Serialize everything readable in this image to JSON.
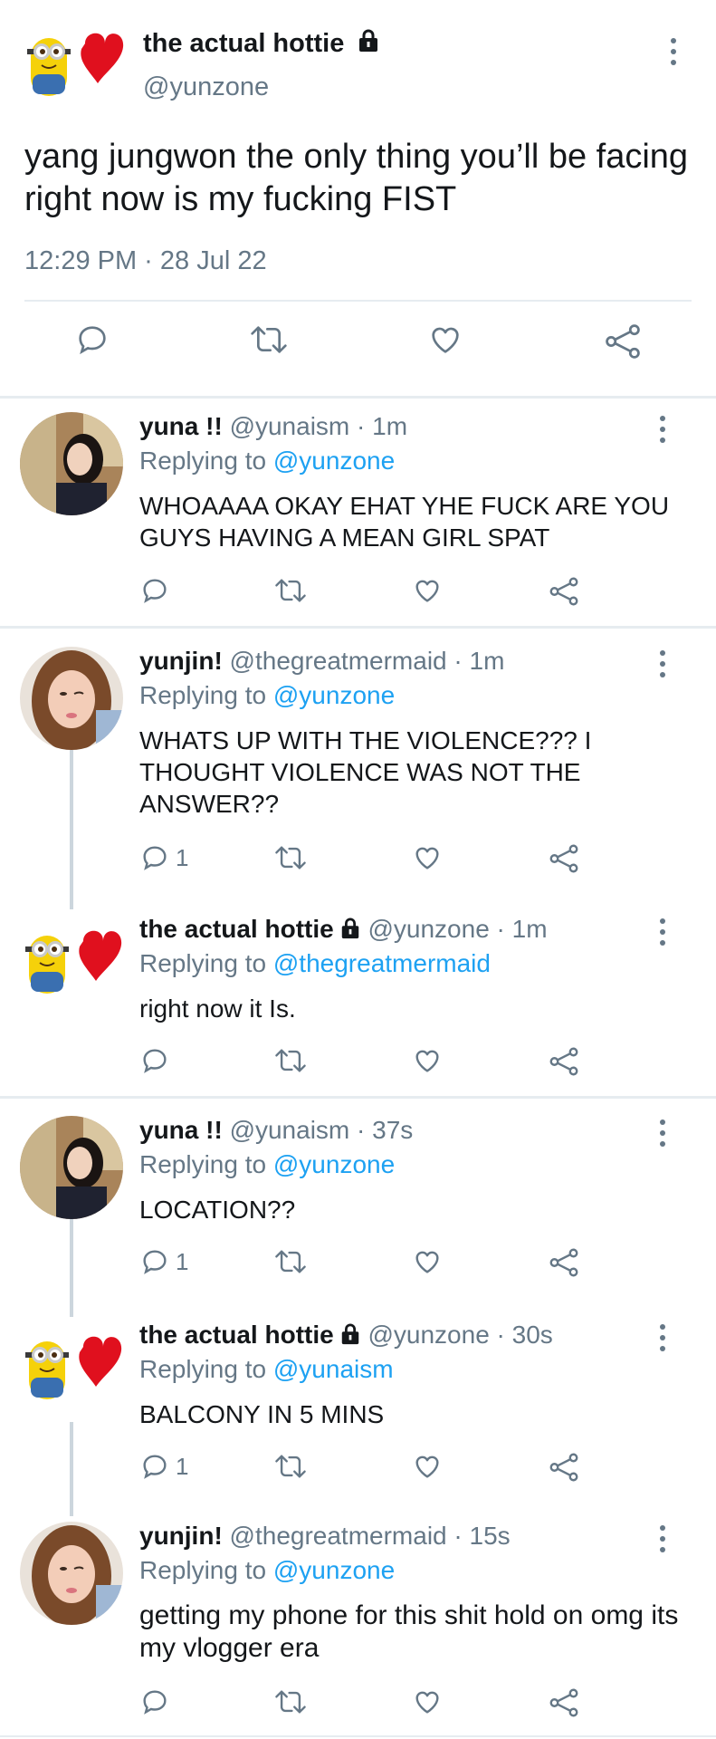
{
  "main_tweet": {
    "display_name": "the actual hottie",
    "handle": "@yunzone",
    "text": "yang jungwon the only thing you’ll be facing right now is my fucking FIST",
    "timestamp": "12:29 PM · 28 Jul 22"
  },
  "replies": [
    {
      "display_name": "yuna !!",
      "meta": "@yunaism · 1m",
      "replying_prefix": "Replying to",
      "replying_to": "@yunzone",
      "text": "WHOAAAA OKAY EHAT YHE FUCK ARE YOU GUYS HAVING A MEAN GIRL SPAT",
      "reply_count": ""
    },
    {
      "display_name": "yunjin!",
      "meta": "@thegreatmermaid · 1m",
      "replying_prefix": "Replying to",
      "replying_to": "@yunzone",
      "text": "WHATS UP WITH THE VIOLENCE??? I THOUGHT VIOLENCE WAS NOT THE ANSWER??",
      "reply_count": "1"
    },
    {
      "display_name": "the actual hottie",
      "meta": "@yunzone · 1m",
      "replying_prefix": "Replying to",
      "replying_to": "@thegreatmermaid",
      "text": "right now it Is.",
      "reply_count": ""
    },
    {
      "display_name": "yuna !!",
      "meta": "@yunaism · 37s",
      "replying_prefix": "Replying to",
      "replying_to": "@yunzone",
      "text": "LOCATION??",
      "reply_count": "1"
    },
    {
      "display_name": "the actual hottie",
      "meta": "@yunzone · 30s",
      "replying_prefix": "Replying to",
      "replying_to": "@yunaism",
      "text": "BALCONY IN 5 MINS",
      "reply_count": "1"
    },
    {
      "display_name": "yunjin!",
      "meta": "@thegreatmermaid · 15s",
      "replying_prefix": "Replying to",
      "replying_to": "@yunzone",
      "text": "getting my phone for this shit hold on omg its my vlogger era",
      "reply_count": ""
    }
  ],
  "icons": [
    "reply-icon",
    "retweet-icon",
    "like-icon",
    "share-icon",
    "lock-icon",
    "more-options-icon"
  ],
  "colors": {
    "text": "#14171a",
    "secondary": "#657786",
    "link": "#1da1f2",
    "divider": "#e6ecf0",
    "thread_line": "#ccd6dd"
  }
}
